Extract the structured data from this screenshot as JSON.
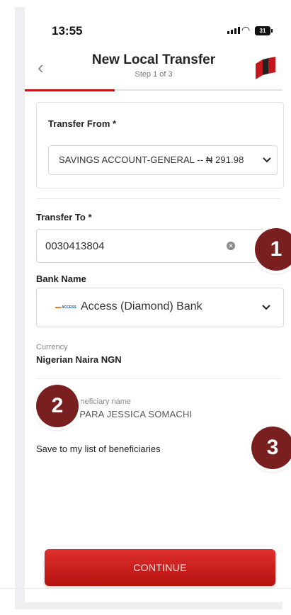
{
  "status_bar": {
    "time": "13:55",
    "battery": "31"
  },
  "header": {
    "title": "New Local Transfer",
    "step": "Step 1 of 3",
    "progress_fraction": 0.35
  },
  "transfer_from": {
    "label": "Transfer From *",
    "value": "SAVINGS ACCOUNT-GENERAL -- ₦ 291.98"
  },
  "transfer_to": {
    "label": "Transfer To *",
    "value": "0030413804"
  },
  "bank": {
    "label": "Bank Name",
    "value": "Access (Diamond) Bank",
    "logo_text": "ACCESS"
  },
  "currency": {
    "label": "Currency",
    "value": "Nigerian Naira NGN"
  },
  "beneficiary": {
    "label": "Beneficiary name",
    "value": "OPARA JESSICA SOMACHI"
  },
  "save_beneficiary": {
    "label": "Save to my list of beneficiaries"
  },
  "annotations": {
    "one": "1",
    "two": "2",
    "three": "3"
  },
  "continue_button": {
    "label": "CONTINUE"
  },
  "colors": {
    "brand_red": "#c4161c",
    "badge": "#7a1f1f"
  },
  "icons": [
    "back-arrow-icon",
    "bank-logo-icon",
    "clear-icon",
    "chevron-down-icon",
    "signal-icon",
    "wifi-icon",
    "battery-icon"
  ]
}
